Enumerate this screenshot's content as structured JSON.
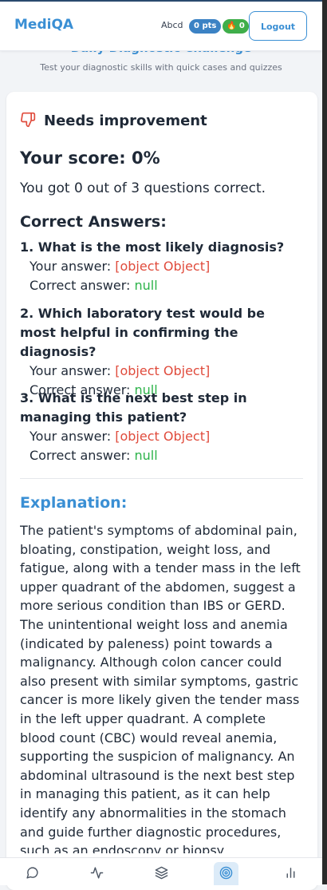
{
  "header": {
    "logo": "MediQA",
    "username": "Abcd",
    "points_badge": "0 pts",
    "streak_badge": "🔥 0",
    "logout_label": "Logout"
  },
  "page": {
    "title": "Daily Diagnostic Challenge",
    "subtitle": "Test your diagnostic skills with quick cases and quizzes"
  },
  "result": {
    "status": "Needs improvement",
    "status_icon": "thumbs-down-icon",
    "score": "Your score: 0%",
    "summary": "You got 0 out of 3 questions correct."
  },
  "answers": {
    "heading": "Correct Answers:",
    "your_answer_label": "Your answer:",
    "correct_answer_label": "Correct answer:",
    "items": [
      {
        "question": "1. What is the most likely diagnosis?",
        "your_answer": "[object Object]",
        "correct_answer": "null"
      },
      {
        "question": "2. Which laboratory test would be most helpful in confirming the diagnosis?",
        "your_answer": "[object Object]",
        "correct_answer": "null"
      },
      {
        "question": "3. What is the next best step in managing this patient?",
        "your_answer": "[object Object]",
        "correct_answer": "null"
      }
    ]
  },
  "explanation": {
    "heading": "Explanation:",
    "text": "The patient's symptoms of abdominal pain, bloating, constipation, weight loss, and fatigue, along with a tender mass in the left upper quadrant of the abdomen, suggest a more serious condition than IBS or GERD. The unintentional weight loss and anemia (indicated by paleness) point towards a malignancy. Although colon cancer could also present with similar symptoms, gastric cancer is more likely given the tender mass in the left upper quadrant. A complete blood count (CBC) would reveal anemia, supporting the suspicion of malignancy. An abdominal ultrasound is the next best step in managing this patient, as it can help identify any abnormalities in the stomach and guide further diagnostic procedures, such as an endoscopy or biopsy."
  },
  "bottom_nav": {
    "items": [
      {
        "icon": "chat-icon",
        "active": false
      },
      {
        "icon": "activity-icon",
        "active": false
      },
      {
        "icon": "layers-icon",
        "active": false
      },
      {
        "icon": "target-icon",
        "active": true
      },
      {
        "icon": "bar-chart-icon",
        "active": false
      }
    ]
  },
  "colors": {
    "accent": "#3a8fd4",
    "wrong": "#e04b3c",
    "right": "#2db34a",
    "points_badge": "#3b82c4",
    "streak_badge": "#3fae4a"
  }
}
